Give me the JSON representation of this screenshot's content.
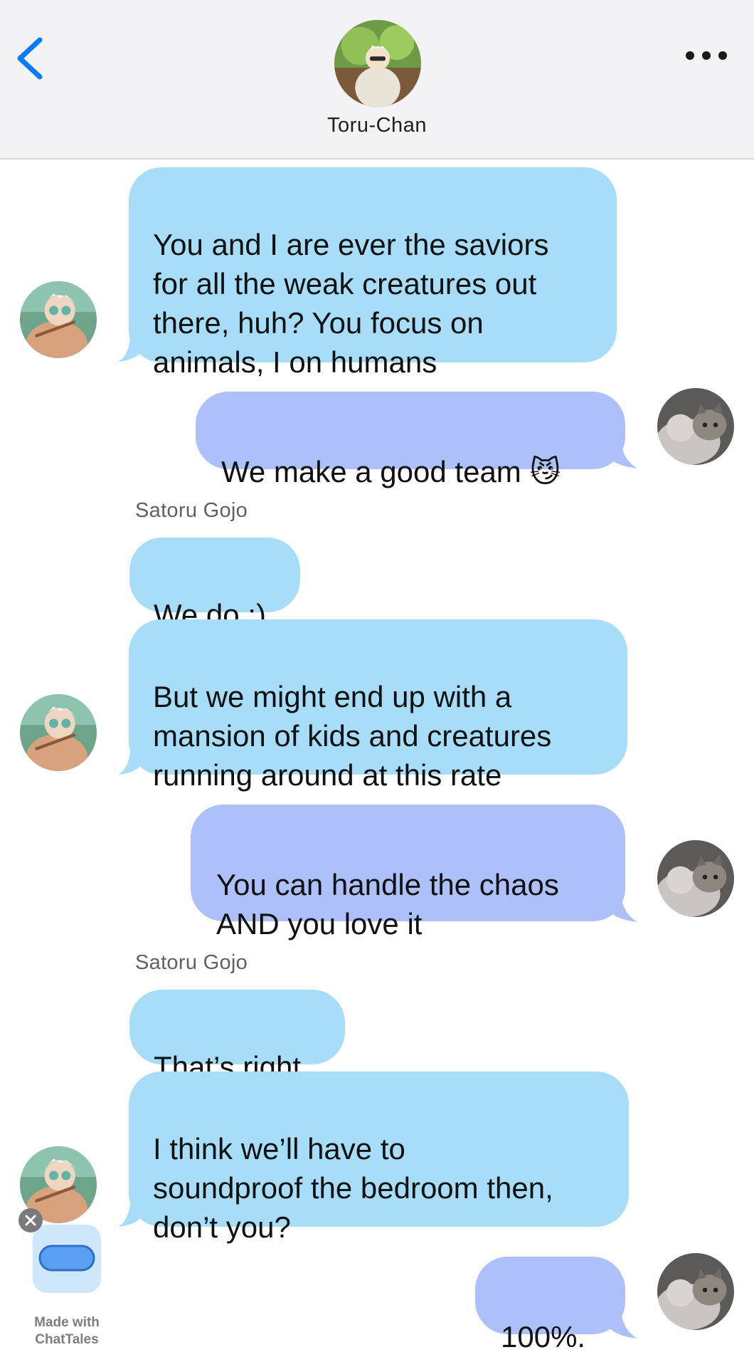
{
  "header": {
    "back_icon": "chevron-left-icon",
    "more_icon": "ellipsis-icon",
    "contact_name": "Toru-Chan",
    "accent_color": "#0a7aff"
  },
  "messages": [
    {
      "side": "incoming",
      "text": "You and I are ever the saviors\nfor all the weak creatures out\nthere, huh? You focus on\nanimals, I on humans"
    },
    {
      "side": "outgoing",
      "text": "We make a good team 😼"
    },
    {
      "side": "incoming",
      "sender": "Satoru Gojo",
      "text": "We do ;)"
    },
    {
      "side": "incoming",
      "text": "But we might end up with a\nmansion of kids and creatures\nrunning around at this rate"
    },
    {
      "side": "outgoing",
      "text": "You can handle the chaos\nAND you love it"
    },
    {
      "side": "incoming",
      "sender": "Satoru Gojo",
      "text": "That’s right"
    },
    {
      "side": "incoming",
      "text": "I think we’ll have to\nsoundproof the bedroom then,\ndon’t you?"
    },
    {
      "side": "outgoing",
      "text": "100%."
    }
  ],
  "colors": {
    "incoming_bubble": "#a7ddf8",
    "outgoing_bubble": "#adc0f9"
  },
  "watermark": {
    "caption": "Made with\nChatTales",
    "close_icon": "close-icon",
    "app_icon": "chat-bubble-icon"
  }
}
